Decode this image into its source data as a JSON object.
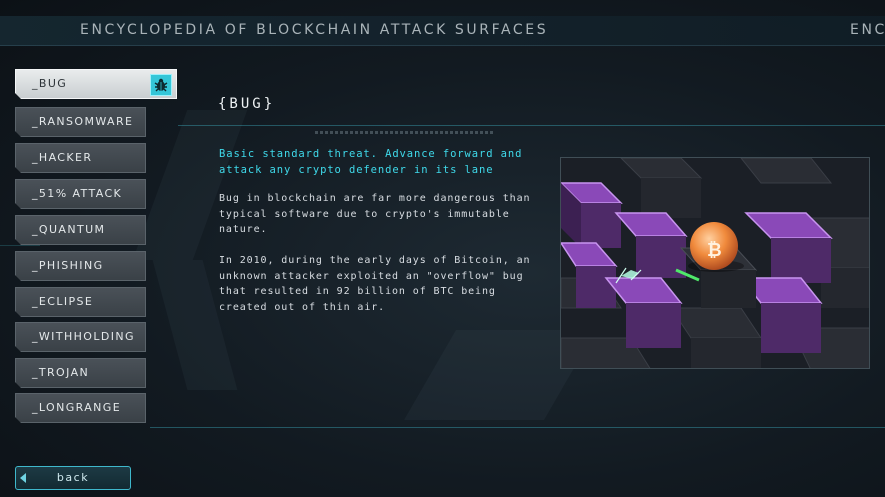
{
  "header": {
    "title": "ENCYCLOPEDIA OF BLOCKCHAIN ATTACK SURFACES",
    "title_repeat": "ENC"
  },
  "menu": {
    "items": [
      {
        "label": "_BUG",
        "active": true,
        "icon": "bug-icon"
      },
      {
        "label": "_RANSOMWARE"
      },
      {
        "label": "_HACKER"
      },
      {
        "label": "_51% ATTACK"
      },
      {
        "label": "_QUANTUM"
      },
      {
        "label": "_PHISHING"
      },
      {
        "label": "_ECLIPSE"
      },
      {
        "label": "_WITHHOLDING"
      },
      {
        "label": "_TROJAN"
      },
      {
        "label": "_LONGRANGE"
      }
    ]
  },
  "content": {
    "title": "{BUG}",
    "tagline": "Basic standard threat. Advance forward and attack any crypto defender in its lane",
    "paragraph1": "Bug in blockchain are far more dangerous than typical software due to crypto's immutable nature.",
    "paragraph2": "In 2010, during the early days of Bitcoin, an unknown attacker exploited an \"overflow\" bug that resulted in 92 billion of BTC being created out of thin air."
  },
  "preview": {
    "icon": "bitcoin-icon",
    "description": "isometric purple block grid with orange bitcoin orb"
  },
  "back_button": {
    "label": "back"
  },
  "colors": {
    "accent": "#3fd9ea",
    "menu_inactive": "#434a50",
    "menu_active": "#dfe3e5",
    "block_top": "#7b3fa6",
    "orb": "#f08a3c"
  }
}
